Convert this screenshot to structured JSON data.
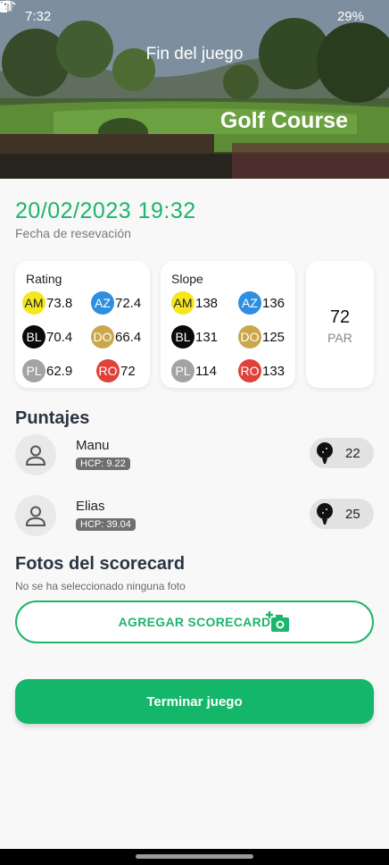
{
  "status": {
    "time": "7:32",
    "battery": "29%"
  },
  "header": {
    "title": "Fin del juego",
    "course": "Golf Course"
  },
  "game": {
    "date": "20/02/2023 19:32",
    "date_label": "Fecha de resevación"
  },
  "rating": {
    "label": "Rating",
    "tees": [
      {
        "code": "AM",
        "value": "73.8",
        "color": "#f5e71b"
      },
      {
        "code": "AZ",
        "value": "72.4",
        "color": "#2e8fe0"
      },
      {
        "code": "BL",
        "value": "70.4",
        "color": "#0a0a0a"
      },
      {
        "code": "DO",
        "value": "66.4",
        "color": "#c9a74a"
      },
      {
        "code": "PL",
        "value": "62.9",
        "color": "#a3a3a3"
      },
      {
        "code": "RO",
        "value": "72",
        "color": "#e0413a"
      }
    ]
  },
  "slope": {
    "label": "Slope",
    "tees": [
      {
        "code": "AM",
        "value": "138",
        "color": "#f5e71b"
      },
      {
        "code": "AZ",
        "value": "136",
        "color": "#2e8fe0"
      },
      {
        "code": "BL",
        "value": "131",
        "color": "#0a0a0a"
      },
      {
        "code": "DO",
        "value": "125",
        "color": "#c9a74a"
      },
      {
        "code": "PL",
        "value": "114",
        "color": "#a3a3a3"
      },
      {
        "code": "RO",
        "value": "133",
        "color": "#e0413a"
      }
    ]
  },
  "par": {
    "value": "72",
    "label": "PAR"
  },
  "scores": {
    "title": "Puntajes",
    "players": [
      {
        "name": "Manu",
        "hcp": "HCP: 9.22",
        "score": "22"
      },
      {
        "name": "Elias",
        "hcp": "HCP: 39.04",
        "score": "25"
      }
    ]
  },
  "scorecard": {
    "title": "Fotos del scorecard",
    "empty_text": "No se ha seleccionado ninguna foto",
    "add_label": "AGREGAR SCORECARD"
  },
  "actions": {
    "finish_label": "Terminar juego"
  },
  "colors": {
    "accent": "#1db56b",
    "primary_button": "#14b66a"
  }
}
